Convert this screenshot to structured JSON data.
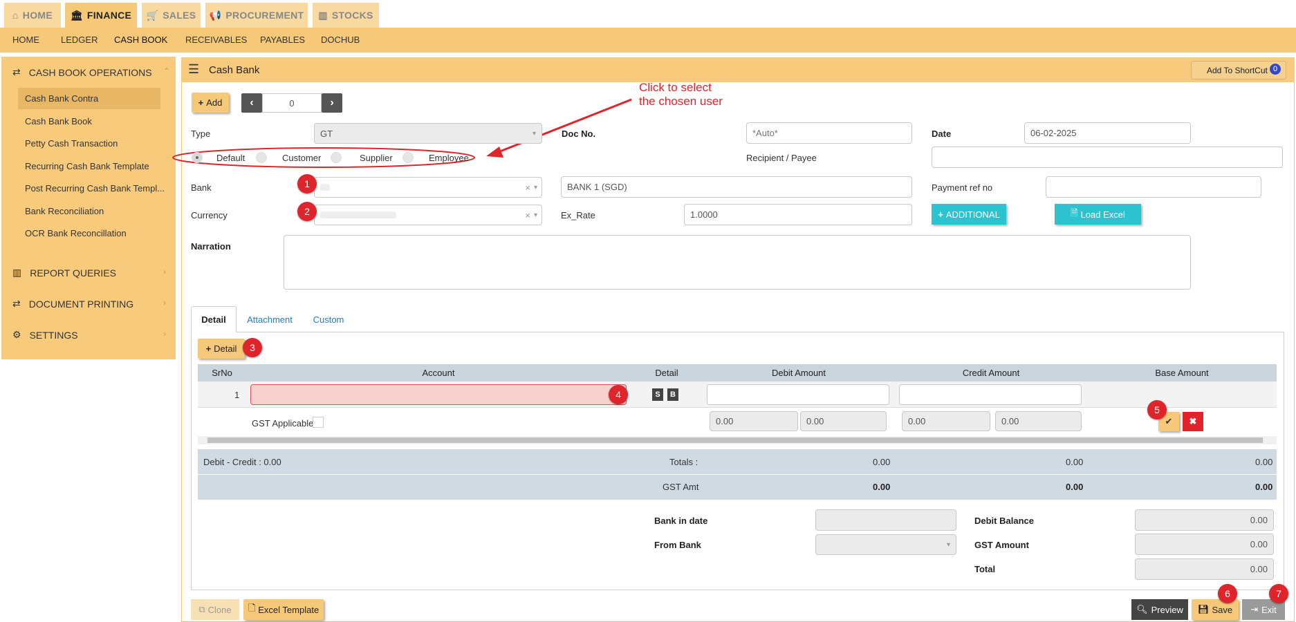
{
  "modules": [
    {
      "label": "HOME",
      "icon": "home-icon"
    },
    {
      "label": "FINANCE",
      "icon": "bank-icon"
    },
    {
      "label": "SALES",
      "icon": "cart-icon"
    },
    {
      "label": "PROCUREMENT",
      "icon": "megaphone-icon"
    },
    {
      "label": "STOCKS",
      "icon": "bar-chart-icon"
    }
  ],
  "subnav": [
    "HOME",
    "LEDGER",
    "CASH BOOK",
    "RECEIVABLES",
    "PAYABLES",
    "DOCHUB"
  ],
  "sidebar": {
    "section1": "CASH BOOK OPERATIONS",
    "items": [
      "Cash Bank Contra",
      "Cash Bank Book",
      "Petty Cash Transaction",
      "Recurring Cash Bank Template",
      "Post Recurring Cash Bank Templ...",
      "Bank Reconciliation",
      "OCR Bank Reconcillation"
    ],
    "section2": "REPORT QUERIES",
    "section3": "DOCUMENT PRINTING",
    "section4": "SETTINGS"
  },
  "panel": {
    "title": "Cash Bank",
    "shortcut_label": "Add To ShortCut",
    "shortcut_count": "0"
  },
  "toolbar": {
    "add_label": "Add",
    "nav_value": "0"
  },
  "annotation": {
    "line1": "Click to select",
    "line2": "the chosen user"
  },
  "form": {
    "type_label": "Type",
    "type_value": "GT",
    "docno_label": "Doc No.",
    "docno_placeholder": "*Auto*",
    "date_label": "Date",
    "date_value": "06-02-2025",
    "recipient_label": "Recipient / Payee",
    "radios": [
      "Default",
      "Customer",
      "Supplier",
      "Employee"
    ],
    "bank_label": "Bank",
    "bank_name_value": "BANK 1 (SGD)",
    "payment_ref_label": "Payment ref no",
    "currency_label": "Currency",
    "ex_rate_label": "Ex_Rate",
    "ex_rate_value": "1.0000",
    "additional_label": "ADDITIONAL",
    "load_excel_label": "Load Excel",
    "narration_label": "Narration"
  },
  "tabs": [
    "Detail",
    "Attachment",
    "Custom"
  ],
  "detail": {
    "add_detail_label": "Detail",
    "columns": [
      "SrNo",
      "Account",
      "Detail",
      "Debit Amount",
      "Credit Amount",
      "Base Amount"
    ],
    "row_no": "1",
    "detail_btn_s": "S",
    "detail_btn_b": "B",
    "gst_label": "GST Applicable",
    "zero": "0.00"
  },
  "totals": {
    "diff_label": "Debit - Credit : 0.00",
    "totals_label": "Totals :",
    "gst_amt_label": "GST Amt",
    "debit": "0.00",
    "credit": "0.00",
    "base": "0.00",
    "gst_debit": "0.00",
    "gst_credit": "0.00",
    "gst_base": "0.00"
  },
  "summary": {
    "bank_in_date_label": "Bank in date",
    "from_bank_label": "From Bank",
    "debit_balance_label": "Debit Balance",
    "debit_balance_value": "0.00",
    "gst_amount_label": "GST Amount",
    "gst_amount_value": "0.00",
    "total_label": "Total",
    "total_value": "0.00"
  },
  "footer": {
    "clone_label": "Clone",
    "excel_template_label": "Excel Template",
    "preview_label": "Preview",
    "save_label": "Save",
    "exit_label": "Exit"
  },
  "badges": [
    "1",
    "2",
    "3",
    "4",
    "5",
    "6",
    "7"
  ],
  "colors": {
    "accent": "#f5c978",
    "teal": "#2bc3cf",
    "badge": "#e0242c",
    "annotation": "#e0242c"
  }
}
